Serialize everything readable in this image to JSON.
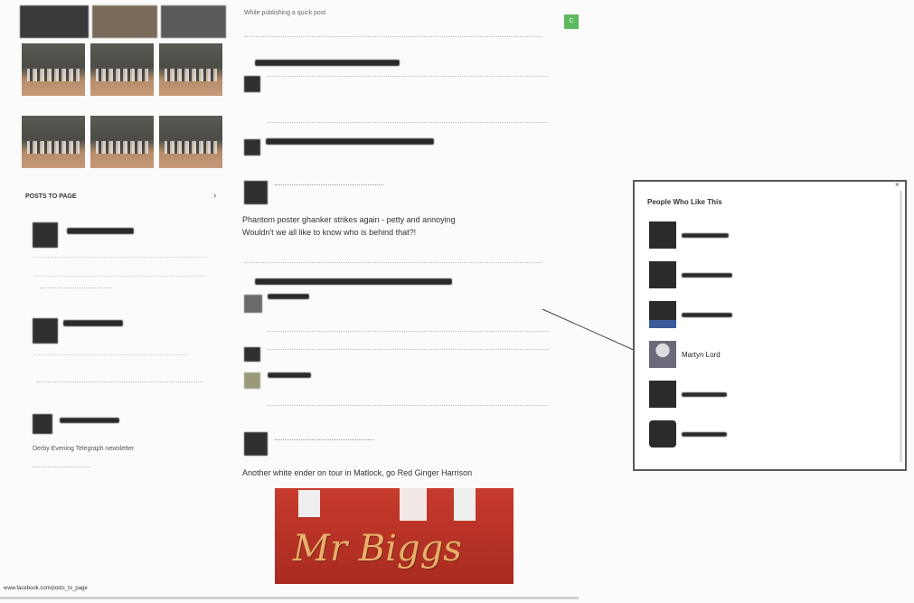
{
  "left": {
    "section_title": "POSTS TO PAGE",
    "section_arrow": "›",
    "posts": [
      {
        "caption": "Derby Evening Telegraph newsletter"
      }
    ]
  },
  "feed": {
    "top_text": "While publishing a quick post",
    "post1_text": "Phantom poster ghanker strikes again - petty and annoying",
    "post1_text2": "Wouldn't we all like to know who is behind that?!",
    "post2_text": "Another white ender on tour in Matlock, go Red Ginger Harrison",
    "image_text": "Mr Biggs"
  },
  "popup": {
    "title": "People Who Like This",
    "close": "×",
    "people": [
      {
        "name": ""
      },
      {
        "name": ""
      },
      {
        "name": ""
      },
      {
        "name": "Martyn Lord"
      },
      {
        "name": ""
      },
      {
        "name": ""
      }
    ]
  },
  "status_bar": "www.facebook.com/posts_to_page",
  "green_button": "C"
}
